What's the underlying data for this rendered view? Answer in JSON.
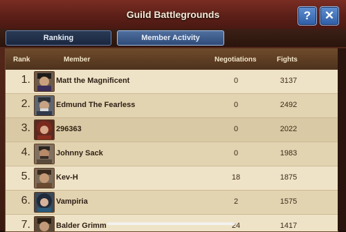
{
  "header": {
    "title": "Guild Battlegrounds",
    "help_label": "?",
    "close_label": "✕"
  },
  "tabs": [
    {
      "label": "Ranking"
    },
    {
      "label": "Member Activity"
    }
  ],
  "columns": {
    "rank": "Rank",
    "member": "Member",
    "negotiations": "Negotiations",
    "fights": "Fights"
  },
  "rows": [
    {
      "rank": "1.",
      "member": "Matt the Magnificent",
      "negotiations": "0",
      "fights": "3137"
    },
    {
      "rank": "2.",
      "member": "Edmund The Fearless",
      "negotiations": "0",
      "fights": "2492"
    },
    {
      "rank": "3.",
      "member": "296363",
      "negotiations": "0",
      "fights": "2022"
    },
    {
      "rank": "4.",
      "member": "Johnny Sack",
      "negotiations": "0",
      "fights": "1983"
    },
    {
      "rank": "5.",
      "member": "Kev-H",
      "negotiations": "18",
      "fights": "1875"
    },
    {
      "rank": "6.",
      "member": "Vampiria",
      "negotiations": "2",
      "fights": "1575"
    },
    {
      "rank": "7.",
      "member": "Balder Grimm",
      "negotiations": "24",
      "fights": "1417"
    }
  ],
  "colors": {
    "accent": "#2f5ea8",
    "header_bg": "#5c1f18",
    "panel_bg": "#e8dcc0"
  }
}
